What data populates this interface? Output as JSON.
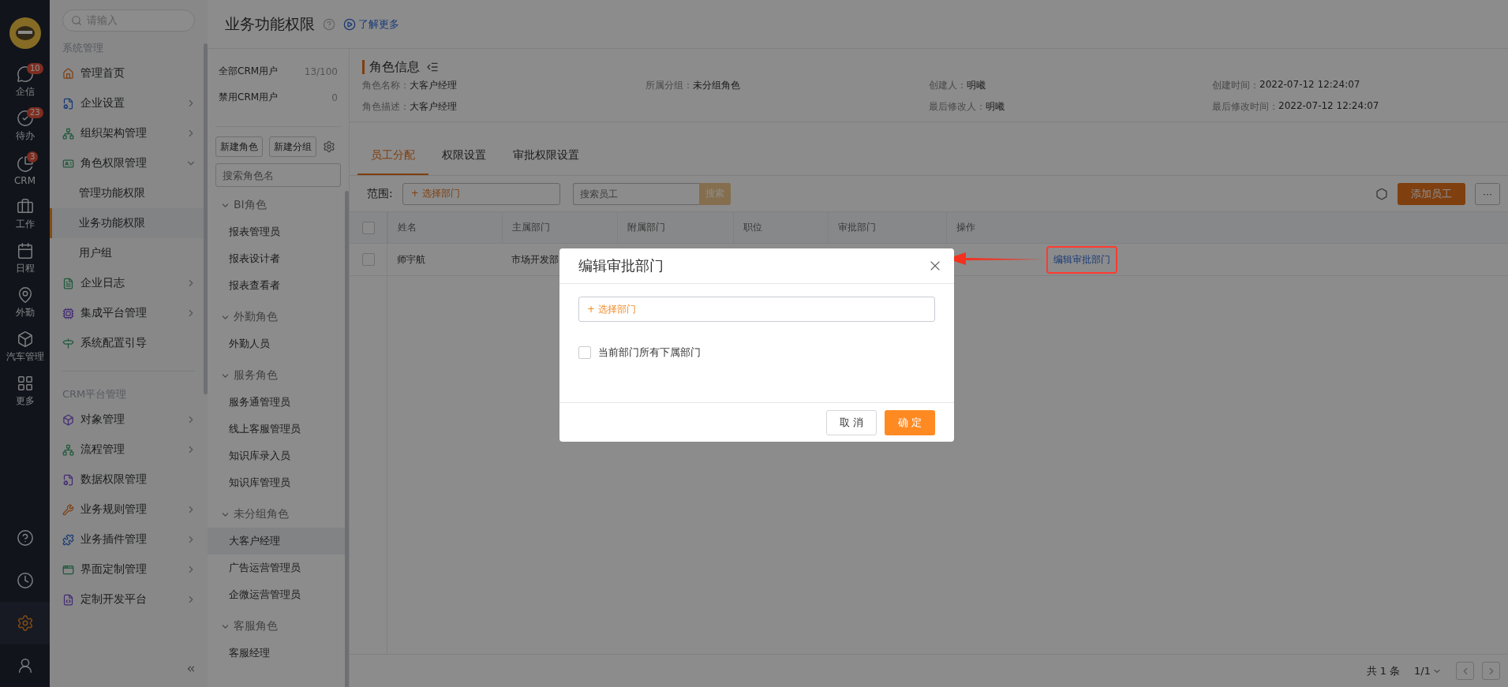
{
  "rail": {
    "top": [
      {
        "label": "企信",
        "badge": "10"
      },
      {
        "label": "待办",
        "badge": "23"
      },
      {
        "label": "CRM",
        "badge": "3"
      },
      {
        "label": "工作"
      },
      {
        "label": "日程"
      },
      {
        "label": "外勤"
      },
      {
        "label": "汽车管理"
      },
      {
        "label": "更多"
      }
    ],
    "bottom": [
      {
        "selected": false
      },
      {
        "selected": false
      },
      {
        "selected": true
      },
      {
        "selected": false
      }
    ]
  },
  "sidebar": {
    "search": {
      "placeholder": "请输入"
    },
    "sections": [
      {
        "title": "系统管理",
        "items": [
          {
            "label": "管理首页"
          },
          {
            "label": "企业设置",
            "expanded": false
          },
          {
            "label": "组织架构管理",
            "expanded": false
          },
          {
            "label": "角色权限管理",
            "expanded": true,
            "children": [
              {
                "label": "管理功能权限",
                "selected": false
              },
              {
                "label": "业务功能权限",
                "selected": true
              },
              {
                "label": "用户组",
                "selected": false
              }
            ]
          },
          {
            "label": "企业日志",
            "expanded": false
          },
          {
            "label": "集成平台管理",
            "expanded": false
          },
          {
            "label": "系统配置引导"
          }
        ]
      },
      {
        "title": "CRM平台管理",
        "items": [
          {
            "label": "对象管理",
            "expanded": false
          },
          {
            "label": "流程管理",
            "expanded": false
          },
          {
            "label": "数据权限管理"
          },
          {
            "label": "业务规则管理",
            "expanded": false
          },
          {
            "label": "业务插件管理",
            "expanded": false
          },
          {
            "label": "界面定制管理",
            "expanded": false
          },
          {
            "label": "定制开发平台",
            "expanded": false
          }
        ]
      }
    ]
  },
  "header": {
    "title": "业务功能权限",
    "link": "了解更多"
  },
  "roles": {
    "counts": [
      {
        "label": "全部CRM用户",
        "count": "13/100"
      },
      {
        "label": "禁用CRM用户",
        "count": "0"
      }
    ],
    "buttons": [
      "新建角色",
      "新建分组"
    ],
    "search": {
      "placeholder": "搜索角色名"
    },
    "groups": [
      {
        "title": "BI角色",
        "expanded": true,
        "items": [
          {
            "label": "报表管理员",
            "selected": false
          },
          {
            "label": "报表设计者",
            "selected": false
          },
          {
            "label": "报表查看者",
            "selected": false
          }
        ]
      },
      {
        "title": "外勤角色",
        "expanded": true,
        "items": [
          {
            "label": "外勤人员",
            "selected": false
          }
        ]
      },
      {
        "title": "服务角色",
        "expanded": true,
        "items": [
          {
            "label": "服务通管理员",
            "selected": false
          },
          {
            "label": "线上客服管理员",
            "selected": false
          },
          {
            "label": "知识库录入员",
            "selected": false
          },
          {
            "label": "知识库管理员",
            "selected": false
          }
        ]
      },
      {
        "title": "未分组角色",
        "expanded": true,
        "items": [
          {
            "label": "大客户经理",
            "selected": true
          },
          {
            "label": "广告运营管理员",
            "selected": false
          },
          {
            "label": "企微运营管理员",
            "selected": false
          }
        ]
      },
      {
        "title": "客服角色",
        "expanded": true,
        "items": [
          {
            "label": "客服经理",
            "selected": false
          }
        ]
      }
    ]
  },
  "role_info": {
    "title": "角色信息",
    "rows": [
      [
        {
          "label": "角色名称：",
          "value": "大客户经理"
        },
        {
          "label": "所属分组：",
          "value": "未分组角色"
        },
        {
          "label": "创建人：",
          "value": "明曦"
        },
        {
          "label": "创建时间：",
          "value": "2022-07-12 12:24:07"
        }
      ],
      [
        {
          "label": "角色描述：",
          "value": "大客户经理"
        },
        null,
        {
          "label": "最后修改人：",
          "value": "明曦"
        },
        {
          "label": "最后修改时间：",
          "value": "2022-07-12 12:24:07"
        }
      ]
    ]
  },
  "tabs": [
    {
      "label": "员工分配",
      "selected": true
    },
    {
      "label": "权限设置",
      "selected": false
    },
    {
      "label": "审批权限设置",
      "selected": false
    }
  ],
  "toolbar": {
    "scope_label": "范围:",
    "dept_picker": "+ 选择部门",
    "search": {
      "placeholder": "搜索员工"
    },
    "search_button": "搜索",
    "add_button": "添加员工",
    "more_button": "···"
  },
  "table": {
    "all_selected": false,
    "columns": [
      "姓名",
      "主属部门",
      "附属部门",
      "职位",
      "审批部门",
      "操作"
    ],
    "rows": [
      {
        "selected": false,
        "name": "师宇航",
        "main_dept": "市场开发部",
        "action": "编辑审批部门"
      }
    ]
  },
  "pager": {
    "total": "共 1 条",
    "page": "1/1"
  },
  "dialog": {
    "title": "编辑审批部门",
    "dept_picker": "+ 选择部门",
    "checkbox": {
      "label": "当前部门所有下属部门",
      "checked": false
    },
    "buttons": [
      {
        "label": "取 消",
        "kind": "secondary"
      },
      {
        "label": "确 定",
        "kind": "primary"
      }
    ]
  }
}
